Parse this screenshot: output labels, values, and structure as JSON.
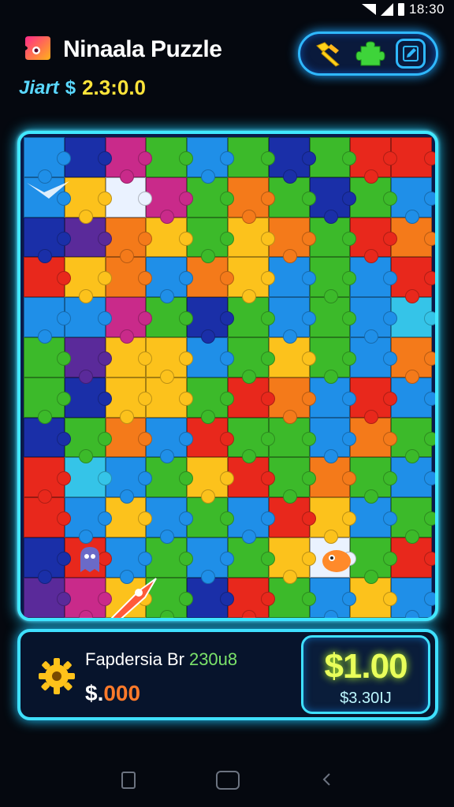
{
  "status_bar": {
    "time": "18:30",
    "icons": [
      "wifi-icon",
      "signal-icon",
      "battery-icon"
    ]
  },
  "header": {
    "title": "Ninaala Puzzle",
    "score_label": "Jiart",
    "score_currency": "$",
    "score_value": "2.3:0.0",
    "tools": [
      "hammer-icon",
      "puzzle-piece-icon",
      "edit-icon"
    ]
  },
  "board": {
    "columns": 10,
    "rows": 12,
    "colors": {
      "R": "#e8281c",
      "O": "#f47a1a",
      "Y": "#fcc21c",
      "G": "#3cba2a",
      "B": "#1f8fe8",
      "N": "#1a2fa8",
      "P": "#c92a8a",
      "V": "#5a2a9a",
      "W": "#eaf2ff",
      "C": "#35c4e8"
    },
    "layout": [
      "BNPGBGNGRR",
      "BYWPGOGNGB",
      "NVOYGYOGRO",
      "RYOBOYBGBR",
      "BBPGNGBGBC",
      "GVYYBGYGBO",
      "GNYYGROBRB",
      "NGOBRGGBOG",
      "RCBGYRGOGB",
      "RBYBGBRYBG",
      "NRBGBGYWGR",
      "VPYGNRGBYB"
    ]
  },
  "panel": {
    "player_name": "Fapdersia Br",
    "player_code": "230u8",
    "cash_symbol": "$.",
    "cash_amount": "000",
    "price": "$1.00",
    "price_sub": "$3.30IJ"
  },
  "navbar": [
    "recent-apps-button",
    "home-button",
    "back-button"
  ]
}
